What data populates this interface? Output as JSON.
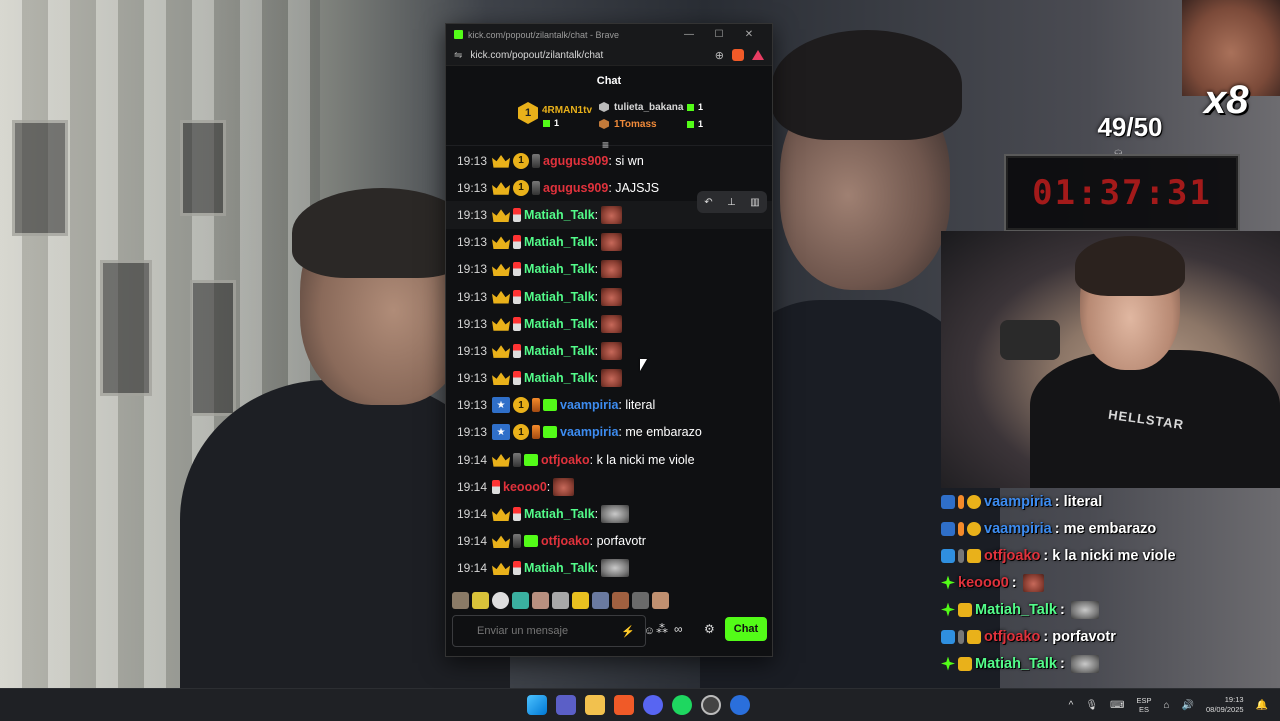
{
  "window": {
    "title": "kick.com/popout/zilantalk/chat - Brave",
    "url": "kick.com/popout/zilantalk/chat",
    "controls": {
      "minimize": "—",
      "maximize": "☐",
      "close": "✕"
    }
  },
  "chat": {
    "header": "Chat",
    "leaderboard": {
      "first": {
        "rank": "1",
        "name": "4RMAN1tv",
        "count": "1"
      },
      "second": {
        "name": "tulieta_bakana",
        "count": "1"
      },
      "third": {
        "name": "1Tomass",
        "count": "1"
      }
    },
    "messages": [
      {
        "time": "19:13",
        "user": "agugus909",
        "color": "#e0323c",
        "text": ": si wn",
        "badges": [
          "crown",
          "coin",
          "glass"
        ],
        "emote": ""
      },
      {
        "time": "19:13",
        "user": "agugus909",
        "color": "#e0323c",
        "text": ": JAJSJS",
        "badges": [
          "crown",
          "coin",
          "glass"
        ],
        "emote": ""
      },
      {
        "time": "19:13",
        "user": "Matiah_Talk",
        "color": "#53fc8a",
        "text": ":",
        "badges": [
          "crown",
          "glass-red"
        ],
        "emote": "red"
      },
      {
        "time": "19:13",
        "user": "Matiah_Talk",
        "color": "#53fc8a",
        "text": ":",
        "badges": [
          "crown",
          "glass-red"
        ],
        "emote": "red"
      },
      {
        "time": "19:13",
        "user": "Matiah_Talk",
        "color": "#53fc8a",
        "text": ":",
        "badges": [
          "crown",
          "glass-red"
        ],
        "emote": "red"
      },
      {
        "time": "19:13",
        "user": "Matiah_Talk",
        "color": "#53fc8a",
        "text": ":",
        "badges": [
          "crown",
          "glass-red"
        ],
        "emote": "red"
      },
      {
        "time": "19:13",
        "user": "Matiah_Talk",
        "color": "#53fc8a",
        "text": ":",
        "badges": [
          "crown",
          "glass-red"
        ],
        "emote": "red"
      },
      {
        "time": "19:13",
        "user": "Matiah_Talk",
        "color": "#53fc8a",
        "text": ":",
        "badges": [
          "crown",
          "glass-red"
        ],
        "emote": "red"
      },
      {
        "time": "19:13",
        "user": "Matiah_Talk",
        "color": "#53fc8a",
        "text": ":",
        "badges": [
          "crown",
          "glass-red"
        ],
        "emote": "red"
      },
      {
        "time": "19:13",
        "user": "vaampiria",
        "color": "#3d8cf0",
        "text": ": literal",
        "badges": [
          "star",
          "coin",
          "glass-or",
          "gift"
        ],
        "emote": ""
      },
      {
        "time": "19:13",
        "user": "vaampiria",
        "color": "#3d8cf0",
        "text": ": me embarazo",
        "badges": [
          "star",
          "coin",
          "glass-or",
          "gift"
        ],
        "emote": ""
      },
      {
        "time": "19:14",
        "user": "otfjoako",
        "color": "#e0323c",
        "text": ": k la nicki me viole",
        "badges": [
          "crown",
          "glass",
          "gift"
        ],
        "emote": ""
      },
      {
        "time": "19:14",
        "user": "keooo0",
        "color": "#e0323c",
        "text": ":",
        "badges": [
          "glass-red"
        ],
        "emote": "red"
      },
      {
        "time": "19:14",
        "user": "Matiah_Talk",
        "color": "#53fc8a",
        "text": ":",
        "badges": [
          "crown",
          "glass-red"
        ],
        "emote": "grey"
      },
      {
        "time": "19:14",
        "user": "otfjoako",
        "color": "#e0323c",
        "text": ": porfavotr",
        "badges": [
          "crown",
          "glass",
          "gift"
        ],
        "emote": ""
      },
      {
        "time": "19:14",
        "user": "Matiah_Talk",
        "color": "#53fc8a",
        "text": ":",
        "badges": [
          "crown",
          "glass-red"
        ],
        "emote": "grey"
      }
    ],
    "message_actions": {
      "reply": "↶",
      "pin": "📌",
      "delete": "🗑"
    },
    "input": {
      "placeholder": "Enviar un mensaje"
    },
    "send_label": "Chat",
    "infinity": "∞"
  },
  "overlay": {
    "meme_multiplier": "x8",
    "goal": "49/50",
    "timer": "01:37:31",
    "cam_logo": "HELLSTAR",
    "chat": [
      {
        "user": "vaampiria",
        "color": "#3d8cf0",
        "text": " : literal",
        "badges": [
          "star",
          "glass-or",
          "coin"
        ],
        "emote": ""
      },
      {
        "user": "vaampiria",
        "color": "#3d8cf0",
        "text": " : me embarazo",
        "badges": [
          "star",
          "glass-or",
          "coin"
        ],
        "emote": ""
      },
      {
        "user": "otfjoako",
        "color": "#e0323c",
        "text": " : k la nicki me viole",
        "badges": [
          "cube",
          "glass",
          "crown"
        ],
        "emote": ""
      },
      {
        "user": "keooo0",
        "color": "#e0323c",
        "text": " :",
        "badges": [
          "sparkle"
        ],
        "emote": "red"
      },
      {
        "user": "Matiah_Talk",
        "color": "#53fc8a",
        "text": " :",
        "badges": [
          "sparkle",
          "crown"
        ],
        "emote": "grey"
      },
      {
        "user": "otfjoako",
        "color": "#e0323c",
        "text": " : porfavotr",
        "badges": [
          "cube",
          "glass",
          "crown"
        ],
        "emote": ""
      },
      {
        "user": "Matiah_Talk",
        "color": "#53fc8a",
        "text": " :",
        "badges": [
          "sparkle",
          "crown"
        ],
        "emote": "grey"
      }
    ]
  },
  "taskbar": {
    "lang_top": "ESP",
    "lang_bottom": "ES",
    "time": "19:13",
    "date": "08/09/2025",
    "tray_chevron": "^"
  },
  "colors": {
    "kick_green": "#53fc18",
    "gold": "#e9b11a"
  }
}
